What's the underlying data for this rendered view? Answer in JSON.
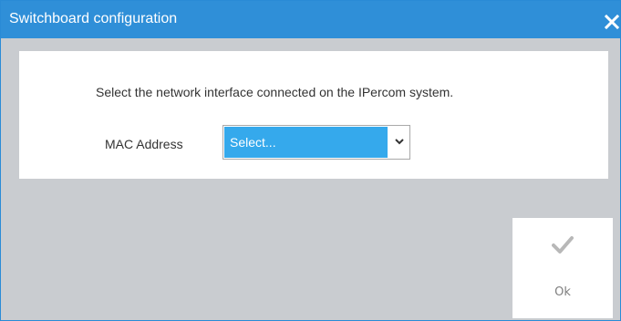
{
  "dialog": {
    "title": "Switchboard configuration",
    "close_icon": "close-icon"
  },
  "content": {
    "instruction": "Select the network interface connected on the IPercom system.",
    "mac_label": "MAC Address",
    "mac_select": {
      "value": "Select...",
      "arrow_icon": "chevron-down-icon"
    }
  },
  "footer": {
    "ok_label": "Ok",
    "ok_icon": "checkmark-icon"
  },
  "colors": {
    "titlebar": "#2f8fd8",
    "select_highlight": "#35a9ec",
    "background": "#c9ccd0"
  }
}
